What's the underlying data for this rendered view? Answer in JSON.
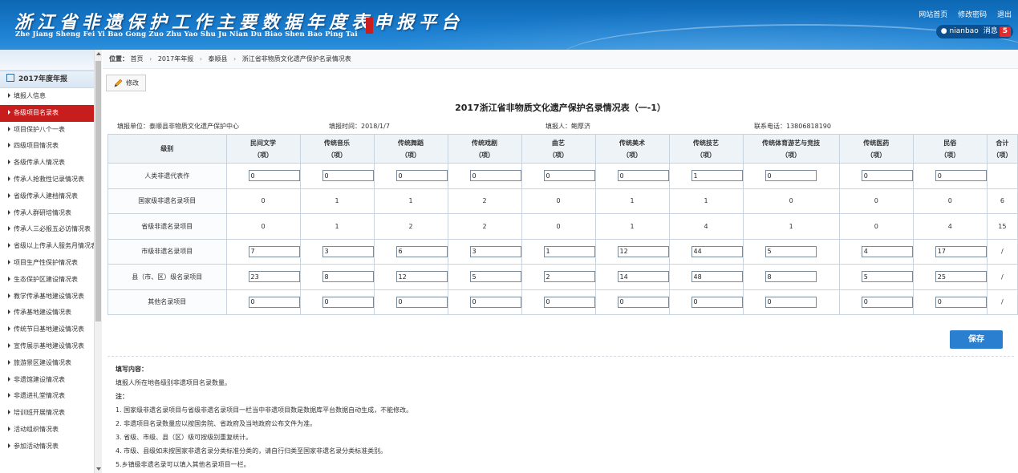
{
  "header": {
    "title": "浙江省非遗保护工作主要数据年度表申报平台",
    "subtitle": "Zhe Jiang Sheng Fei Yi Bao Gong Zuo Zhu Yao Shu Ju Nian Du Biao Shen Bao Ping Tai",
    "links": [
      "网站首页",
      "修改密码",
      "退出"
    ],
    "user": "nianbao",
    "messages_label": "消息",
    "messages_count": "5"
  },
  "sidebar": {
    "group": "2017年度年报",
    "items": [
      "填报人信息",
      "各级项目名录表",
      "项目保护八个一表",
      "四级项目情况表",
      "各级传承人情况表",
      "传承人抢救性记录情况表",
      "省级传承人建档情况表",
      "传承人群研培情况表",
      "传承人三必报五必访情况表",
      "省级以上传承人服务月情况表",
      "项目生产性保护情况表",
      "生态保护区建设情况表",
      "教学传承基地建设情况表",
      "传承基地建设情况表",
      "传统节日基地建设情况表",
      "宣传展示基地建设情况表",
      "旅游景区建设情况表",
      "非遗馆建设情况表",
      "非遗进礼堂情况表",
      "培训班开展情况表",
      "活动组织情况表",
      "参加活动情况表"
    ],
    "active_index": 1
  },
  "breadcrumb": {
    "label": "位置：",
    "items": [
      "首页",
      "2017年年报",
      "泰顺县",
      "浙江省非物质文化遗产保护名录情况表"
    ]
  },
  "toolbar": {
    "edit_label": "修改"
  },
  "form": {
    "title": "2017浙江省非物质文化遗产保护名录情况表（一-1）",
    "unit": "填报单位：泰顺县非物质文化遗产保护中心",
    "time": "填报时间：2018/1/7",
    "person": "填报人：鲍厚济",
    "phone": "联系电话：13806818190"
  },
  "table": {
    "corner": "级别",
    "unit_label": "（项）",
    "columns": [
      "民间文学",
      "传统音乐",
      "传统舞蹈",
      "传统戏剧",
      "曲艺",
      "传统美术",
      "传统技艺",
      "传统体育游艺与竞技",
      "传统医药",
      "民俗",
      "合计"
    ],
    "rows": [
      {
        "label": "人类非遗代表作",
        "type": "input",
        "values": [
          "0",
          "0",
          "0",
          "0",
          "0",
          "0",
          "1",
          "0",
          "0",
          "0"
        ],
        "total": ""
      },
      {
        "label": "国家级非遗名录项目",
        "type": "text",
        "values": [
          "0",
          "1",
          "1",
          "2",
          "0",
          "1",
          "1",
          "0",
          "0",
          "0"
        ],
        "total": "6"
      },
      {
        "label": "省级非遗名录项目",
        "type": "text",
        "values": [
          "0",
          "1",
          "2",
          "2",
          "0",
          "1",
          "4",
          "1",
          "0",
          "4"
        ],
        "total": "15"
      },
      {
        "label": "市级非遗名录项目",
        "type": "input",
        "values": [
          "7",
          "3",
          "6",
          "3",
          "1",
          "12",
          "44",
          "5",
          "4",
          "17"
        ],
        "total": "/"
      },
      {
        "label": "县（市、区）级名录项目",
        "type": "input",
        "values": [
          "23",
          "8",
          "12",
          "5",
          "2",
          "14",
          "48",
          "8",
          "5",
          "25"
        ],
        "total": "/"
      },
      {
        "label": "其他名录项目",
        "type": "input",
        "values": [
          "0",
          "0",
          "0",
          "0",
          "0",
          "0",
          "0",
          "0",
          "0",
          "0"
        ],
        "total": "/"
      }
    ]
  },
  "save_label": "保存",
  "notes": {
    "fill_title": "填写内容：",
    "fill_text": "填报人所在地各级别非遗项目名录数量。",
    "note_title": "注：",
    "items": [
      "1. 国家级非遗名录项目与省级非遗名录项目一栏当中非遗项目数是数据库平台数据自动生成，不能修改。",
      "2. 非遗项目名录数量应以按国务院、省政府及当地政府公布文件为准。",
      "3. 省级、市级、县（区）级可按级别重复统计。",
      "4. 市级、县级如未按国家非遗名录分类标准分类的，请自行归类至国家非遗名录分类标准类别。",
      "5.乡镇级非遗名录可以填入其他名录项目一栏。"
    ]
  },
  "colors": {
    "header": "#1a7ccd",
    "active_nav": "#c71d1d",
    "save": "#2a7fd0",
    "badge": "#e02c2c"
  }
}
